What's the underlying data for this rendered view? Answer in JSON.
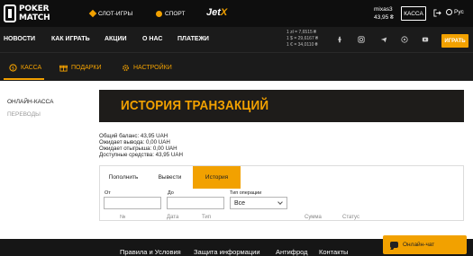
{
  "brand": {
    "logo_text_line1": "POKER",
    "logo_text_line2": "MATCH"
  },
  "topnav": {
    "slots": "СЛОТ-ИГРЫ",
    "sport": "СПОРТ",
    "jetx_a": "Jet",
    "jetx_b": "X",
    "username": "mixas3",
    "balance": "43,95 ₴",
    "kassa_button": "КАССА",
    "language": "Рус"
  },
  "nav": {
    "items": [
      "НОВОСТИ",
      "КАК ИГРАТЬ",
      "АКЦИИ",
      "О НАС",
      "ПЛАТЕЖИ"
    ],
    "rates": [
      "1 zł = 7,6515 ₴",
      "1 $ = 29,6167 ₴",
      "1 € = 34,0110 ₴"
    ],
    "deposit_button": "ИГРАТЬ"
  },
  "subnav": {
    "items": [
      "КАССА",
      "ПОДАРКИ",
      "НАСТРОЙКИ"
    ]
  },
  "left_menu": {
    "items": [
      "ОНЛАЙН-КАССА",
      "ПЕРЕВОДЫ"
    ]
  },
  "banner": {
    "title": "ИСТОРИЯ ТРАНЗАКЦИЙ"
  },
  "balances": {
    "total": "Общий баланс: 43,95 UAH",
    "withdraw_pending": "Ожидает вывода: 0,00 UAH",
    "wager_pending": "Ожидает отыгрыша: 0,00 UAH",
    "available": "Доступные средства: 43,95 UAH"
  },
  "tabs": {
    "items": [
      "Пополнить",
      "Вывести",
      "История"
    ],
    "active_index": 2
  },
  "filters": {
    "from_label": "От",
    "to_label": "До",
    "from_value": "",
    "to_value": "",
    "type_label": "Тип операции",
    "type_value": "Все"
  },
  "table": {
    "columns": [
      "№",
      "Дата",
      "Тип",
      "Сумма",
      "Статус"
    ]
  },
  "footer": {
    "links": [
      "Правила и Условия",
      "Защита информации",
      "Антифрод",
      "Контакты"
    ]
  },
  "chat": {
    "label": "Онлайн-чат"
  },
  "colors": {
    "accent": "#f2a100",
    "dark": "#0e0e0e",
    "nav": "#1b1b1b"
  }
}
